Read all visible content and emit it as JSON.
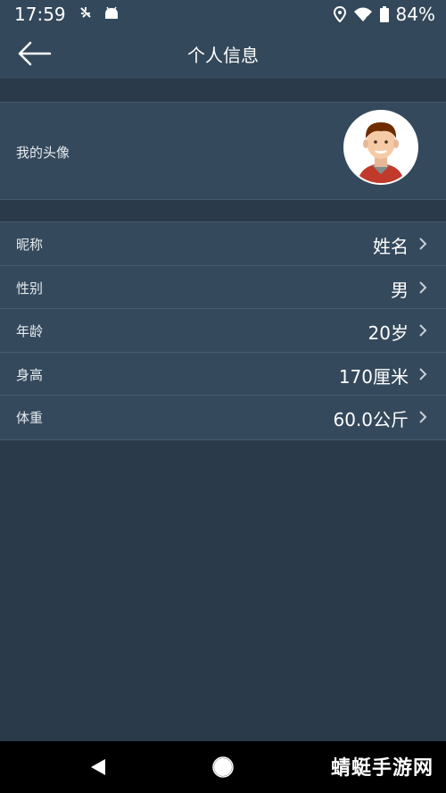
{
  "status_bar": {
    "time": "17:59",
    "battery_percent": "84%",
    "icons": [
      "bug-icon",
      "android-icon",
      "location-icon",
      "wifi-icon",
      "battery-icon"
    ]
  },
  "header": {
    "title": "个人信息",
    "back_icon": "back-arrow-icon"
  },
  "avatar_row": {
    "label": "我的头像"
  },
  "info_rows": [
    {
      "label": "昵称",
      "value": "姓名"
    },
    {
      "label": "性别",
      "value": "男"
    },
    {
      "label": "年龄",
      "value": "20岁"
    },
    {
      "label": "身高",
      "value": "170厘米"
    },
    {
      "label": "体重",
      "value": "60.0公斤"
    }
  ],
  "nav_bar": {
    "icons": [
      "back-triangle-icon",
      "home-circle-icon"
    ]
  },
  "watermark": {
    "text": "蜻蜓手游网"
  },
  "colors": {
    "background": "#2b3a4a",
    "header": "#33485a",
    "row": "#34495b",
    "divider": "#4a5c6c"
  }
}
